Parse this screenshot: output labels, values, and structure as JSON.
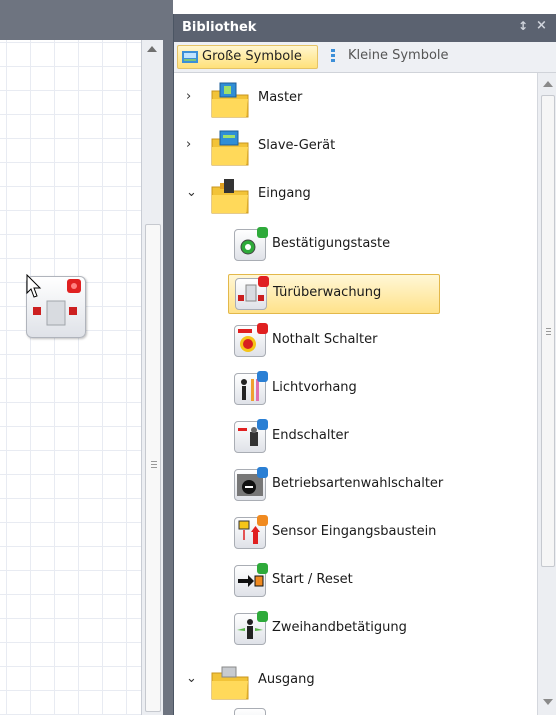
{
  "panel": {
    "title": "Bibliothek",
    "pin_glyph": "↕",
    "close_glyph": "×"
  },
  "toolbar": {
    "large_icons_label": "Große Symbole",
    "small_icons_label": "Kleine Symbole"
  },
  "tree": {
    "categories": [
      {
        "label": "Master",
        "expanded": false,
        "icon": "master-folder-icon"
      },
      {
        "label": "Slave-Gerät",
        "expanded": false,
        "icon": "slave-folder-icon"
      },
      {
        "label": "Eingang",
        "expanded": true,
        "icon": "input-folder-icon"
      },
      {
        "label": "Ausgang",
        "expanded": true,
        "icon": "output-folder-icon"
      }
    ],
    "items": [
      {
        "label": "Bestätigungstaste",
        "badge_color": "#2eaa3a",
        "icon": "confirm-button-icon"
      },
      {
        "label": "Türüberwachung",
        "badge_color": "#e02020",
        "icon": "door-monitoring-icon",
        "selected": true
      },
      {
        "label": "Nothalt Schalter",
        "badge_color": "#e02020",
        "icon": "emergency-stop-icon"
      },
      {
        "label": "Lichtvorhang",
        "badge_color": "#2a7fd4",
        "icon": "light-curtain-icon"
      },
      {
        "label": "Endschalter",
        "badge_color": "#2a7fd4",
        "icon": "limit-switch-icon"
      },
      {
        "label": "Betriebsartenwahlschalter",
        "badge_color": "#2a7fd4",
        "icon": "mode-selector-icon"
      },
      {
        "label": "Sensor Eingangsbaustein",
        "badge_color": "#f08a20",
        "icon": "sensor-input-icon"
      },
      {
        "label": "Start / Reset",
        "badge_color": "#2eaa3a",
        "icon": "start-reset-icon"
      },
      {
        "label": "Zweihandbetätigung",
        "badge_color": "#2eaa3a",
        "icon": "two-hand-control-icon"
      }
    ]
  },
  "colors": {
    "panel_header": "#5b6270",
    "selection": "#ffe28a",
    "canvas_header": "#6e7480"
  }
}
